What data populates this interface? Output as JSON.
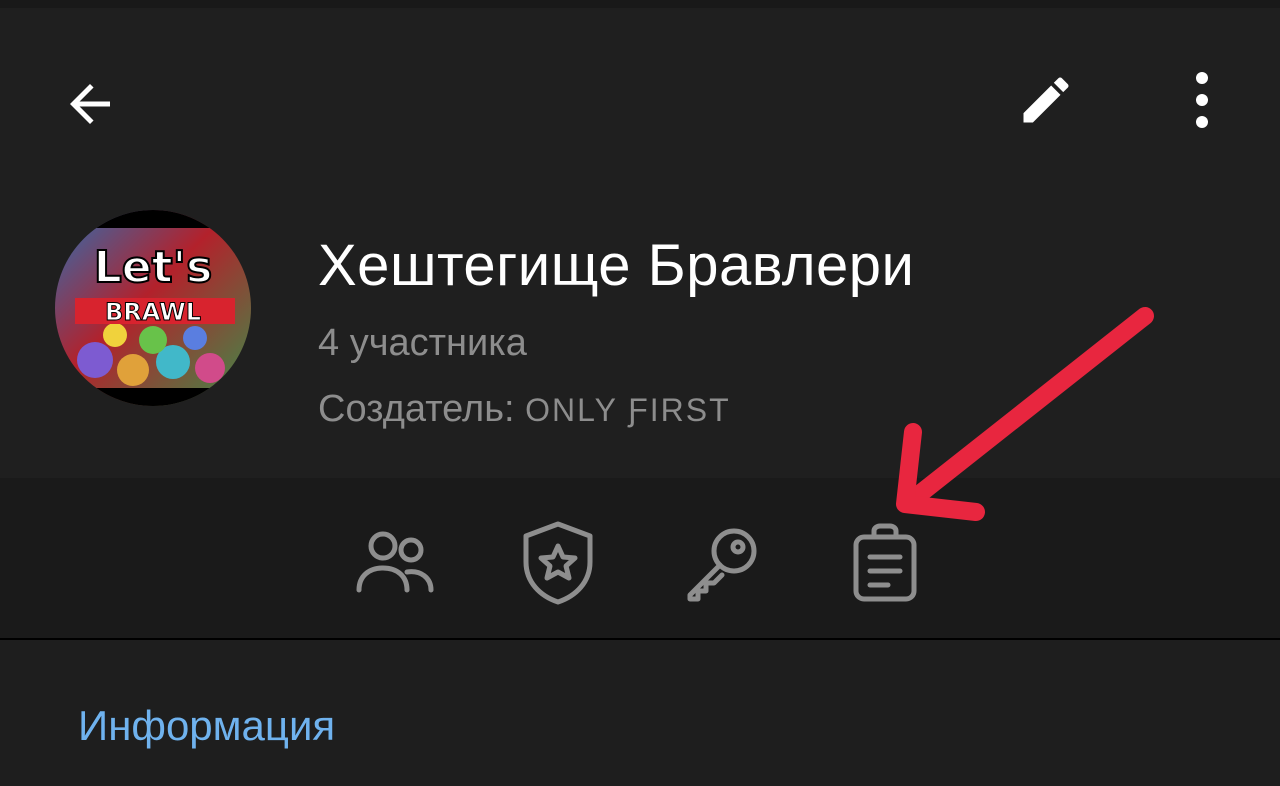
{
  "toolbar": {
    "back_icon": "arrow-left-icon",
    "edit_icon": "pencil-icon",
    "more_icon": "more-vertical-icon"
  },
  "group": {
    "avatar_text_top": "Let's",
    "avatar_text_bottom": "BRAWL",
    "title": "Хештегище Бравлери",
    "members": "4 участника",
    "creator_label": "Создатель: ",
    "creator_name": "ONLY ƑIRST"
  },
  "actions": [
    {
      "icon": "members-icon"
    },
    {
      "icon": "admin-shield-icon"
    },
    {
      "icon": "key-icon"
    },
    {
      "icon": "event-log-clipboard-icon"
    }
  ],
  "info": {
    "title": "Информация"
  },
  "colors": {
    "background": "#1e1e1e",
    "actions_bar": "#1a1a1a",
    "accent": "#6fb2ee",
    "secondary_text": "#8d8d8d",
    "annotation_arrow": "#e8263f"
  }
}
